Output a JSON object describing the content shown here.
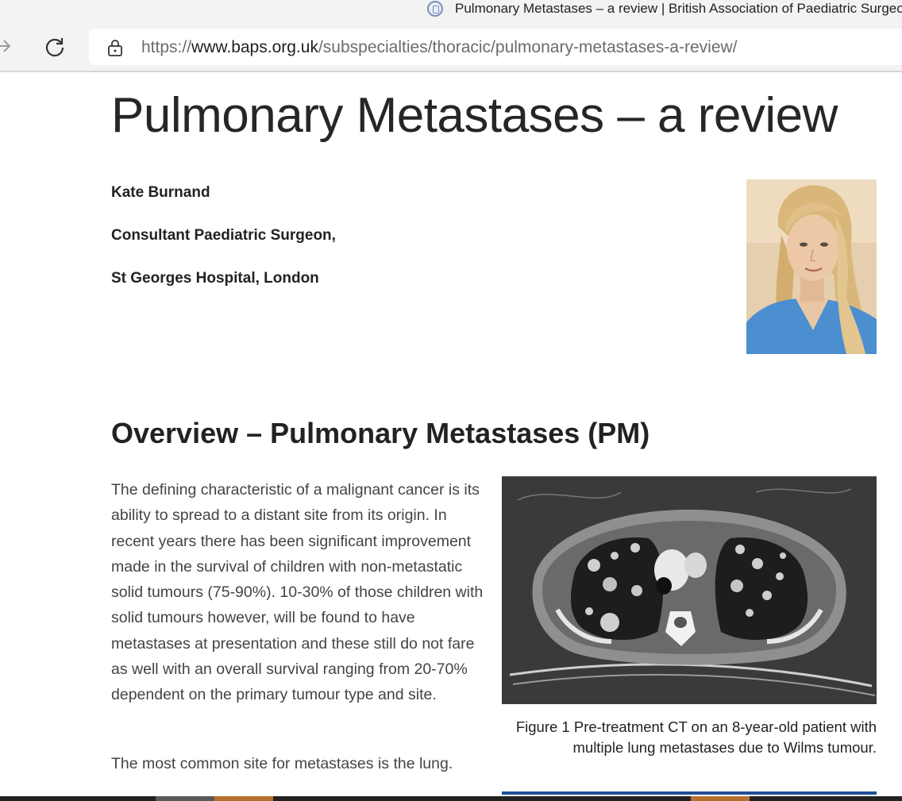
{
  "browser": {
    "tab_title": "Pulmonary Metastases – a review | British Association of Paediatric Surgeons",
    "url_scheme": "https://",
    "url_host": "www.baps.org.uk",
    "url_path": "/subspecialties/thoracic/pulmonary-metastases-a-review/",
    "icons": [
      "favicon-icon",
      "forward-icon",
      "reload-icon",
      "lock-icon"
    ]
  },
  "article": {
    "title": "Pulmonary Metastases – a review",
    "author": {
      "name": "Kate Burnand",
      "role": "Consultant Paediatric Surgeon,",
      "affiliation": "St Georges Hospital, London"
    },
    "section_heading": "Overview – Pulmonary Metastases (PM)",
    "paragraphs": [
      "The defining characteristic of a malignant cancer is its ability to spread to a distant site from its origin. In recent years there has been significant improvement made in the survival of children with non-metastatic solid tumours (75-90%). 10-30% of those children with solid tumours however, will be found to have metastases at presentation and these still do not fare as well with an overall survival ranging from 20-70% dependent on the primary tumour type and site.",
      "The most common site for metastases is the lung."
    ],
    "figure_caption": "Figure 1 Pre-treatment CT on an 8-year-old patient with multiple lung metastases due to Wilms tumour."
  },
  "colors": {
    "chrome_bg": "#f3f3f3",
    "caption_rule": "#1f4e94",
    "photo_bg": "#e6cfae",
    "photo_shirt": "#4b8fd0"
  }
}
